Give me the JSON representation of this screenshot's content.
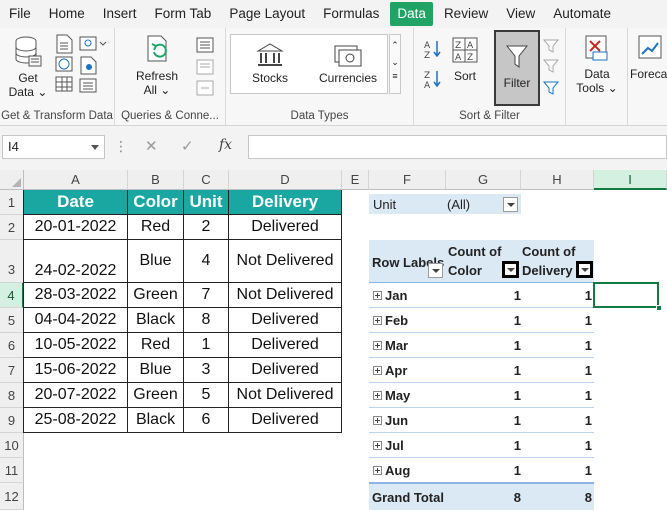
{
  "menu": [
    "File",
    "Home",
    "Insert",
    "Form Tab",
    "Page Layout",
    "Formulas",
    "Data",
    "Review",
    "View",
    "Automate"
  ],
  "active_menu": "Data",
  "ribbon": {
    "get_data": "Get Data",
    "get_transform_label": "Get & Transform Data",
    "refresh_all": "Refresh All",
    "queries_label": "Queries & Conne...",
    "stocks": "Stocks",
    "currencies": "Currencies",
    "data_types_label": "Data Types",
    "sort": "Sort",
    "filter": "Filter",
    "sort_filter_label": "Sort & Filter",
    "data_tools": "Data Tools",
    "forecast": "Foreca"
  },
  "formula_bar": {
    "name_box": "I4",
    "fx": "fx",
    "formula": ""
  },
  "columns": [
    "A",
    "B",
    "C",
    "D",
    "E",
    "F",
    "G",
    "H",
    "I"
  ],
  "selected_column": "I",
  "rows": [
    "1",
    "2",
    "3",
    "4",
    "5",
    "6",
    "7",
    "8",
    "9",
    "10",
    "11",
    "12"
  ],
  "selected_row": "4",
  "table": {
    "headers": [
      "Date",
      "Color",
      "Unit",
      "Delivery"
    ],
    "rows": [
      [
        "20-01-2022",
        "Red",
        "2",
        "Delivered"
      ],
      [
        "24-02-2022",
        "Blue",
        "4",
        "Not Delivered"
      ],
      [
        "28-03-2022",
        "Green",
        "7",
        "Not Delivered"
      ],
      [
        "04-04-2022",
        "Black",
        "8",
        "Delivered"
      ],
      [
        "10-05-2022",
        "Red",
        "1",
        "Delivered"
      ],
      [
        "15-06-2022",
        "Blue",
        "3",
        "Delivered"
      ],
      [
        "20-07-2022",
        "Green",
        "5",
        "Not Delivered"
      ],
      [
        "25-08-2022",
        "Black",
        "6",
        "Delivered"
      ]
    ]
  },
  "pivot": {
    "filter_field": "Unit",
    "filter_value": "(All)",
    "row_labels": "Row Labels",
    "col1_line1": "Count of",
    "col1_line2": "Color",
    "col2_line1": "Count of",
    "col2_line2": "Delivery",
    "rows": [
      {
        "label": "Jan",
        "c1": "1",
        "c2": "1"
      },
      {
        "label": "Feb",
        "c1": "1",
        "c2": "1"
      },
      {
        "label": "Mar",
        "c1": "1",
        "c2": "1"
      },
      {
        "label": "Apr",
        "c1": "1",
        "c2": "1"
      },
      {
        "label": "May",
        "c1": "1",
        "c2": "1"
      },
      {
        "label": "Jun",
        "c1": "1",
        "c2": "1"
      },
      {
        "label": "Jul",
        "c1": "1",
        "c2": "1"
      },
      {
        "label": "Aug",
        "c1": "1",
        "c2": "1"
      }
    ],
    "grand_total": {
      "label": "Grand Total",
      "c1": "8",
      "c2": "8"
    }
  },
  "colors": {
    "excel_green": "#21a366",
    "table_header": "#1aa7a1",
    "pivot_header": "#dbe9f5"
  }
}
